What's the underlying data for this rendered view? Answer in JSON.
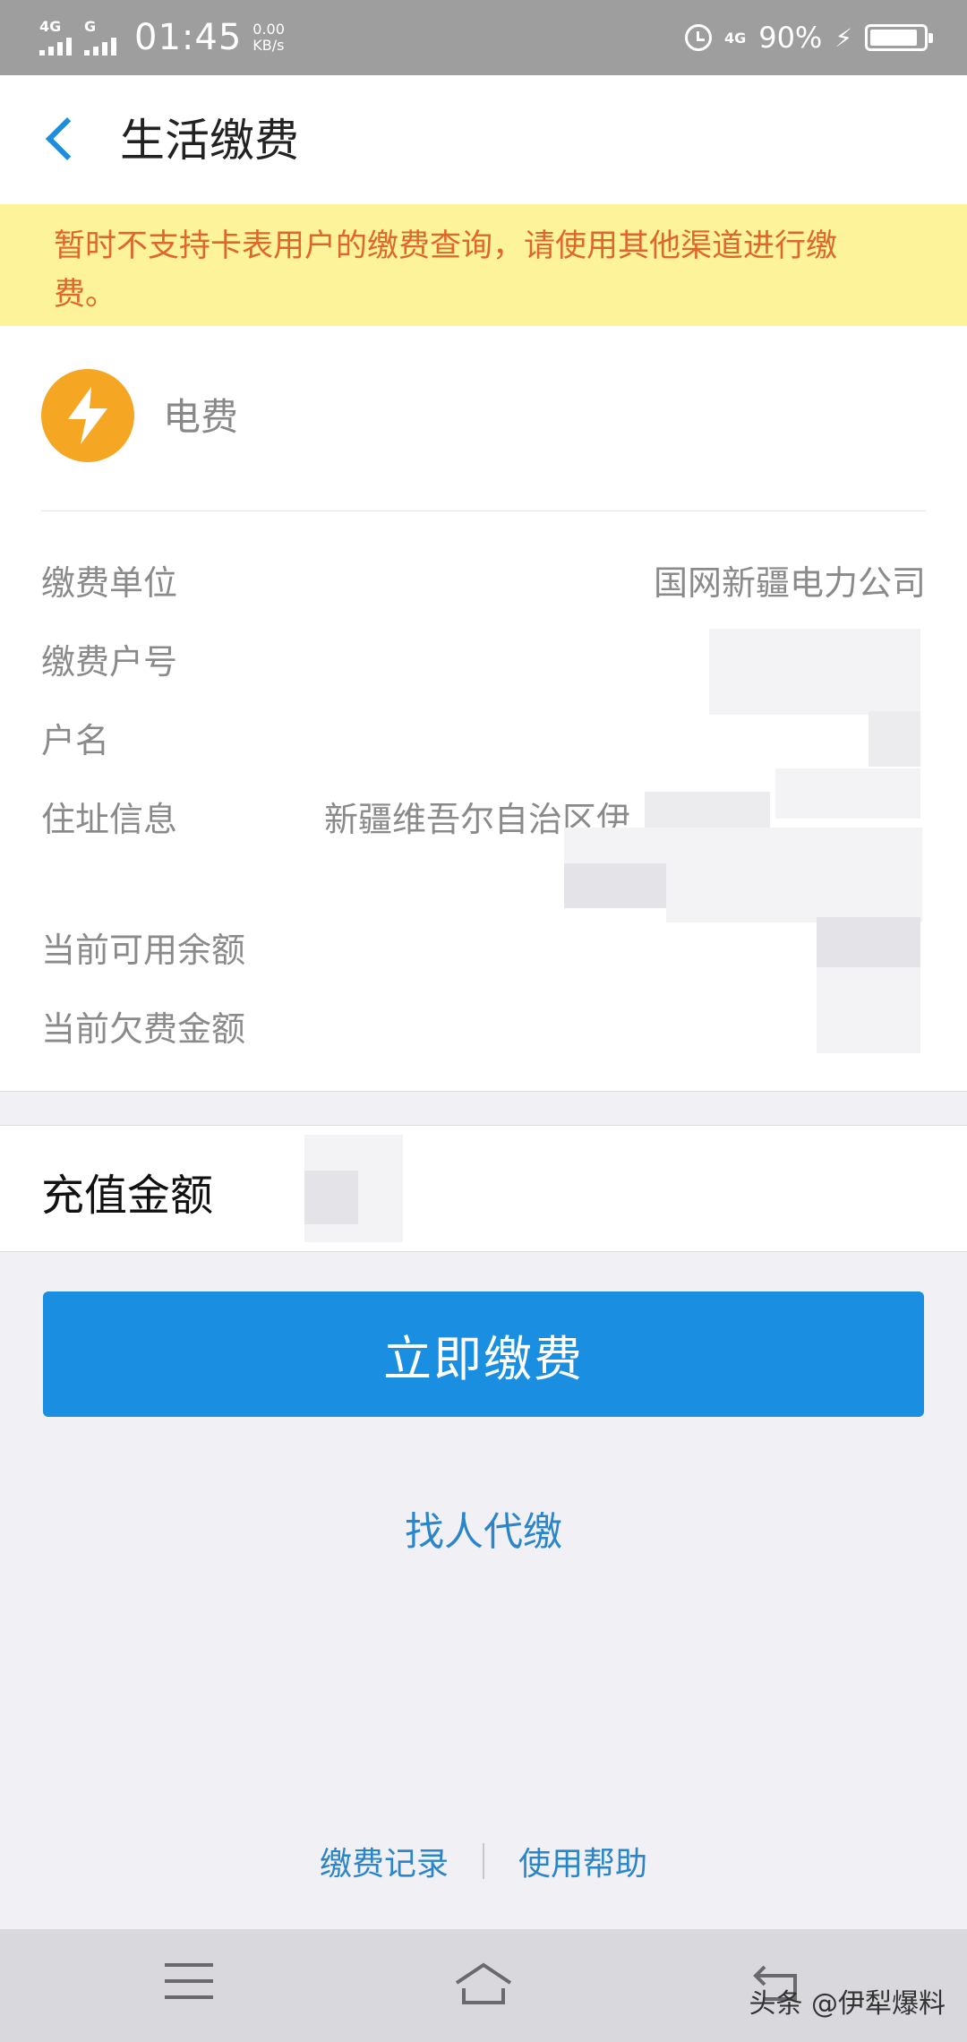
{
  "status_bar": {
    "network_left": "4G",
    "network_right": "G",
    "time": "01:45",
    "speed_value": "0.00",
    "speed_unit": "KB/s",
    "network_status": "4G",
    "battery": "90%"
  },
  "header": {
    "title": "生活缴费"
  },
  "notice": "暂时不支持卡表用户的缴费查询，请使用其他渠道进行缴费。",
  "bill": {
    "name": "电费",
    "icon": "lightning-bolt-icon",
    "rows": [
      {
        "label": "缴费单位",
        "value": "国网新疆电力公司"
      },
      {
        "label": "缴费户号",
        "value": ""
      },
      {
        "label": "户名",
        "value": ""
      },
      {
        "label": "住址信息",
        "value": "新疆维吾尔自治区伊"
      },
      {
        "label": "当前可用余额",
        "value": ""
      },
      {
        "label": "当前欠费金额",
        "value": ""
      }
    ]
  },
  "recharge": {
    "label": "充值金额"
  },
  "pay_button": "立即缴费",
  "proxy_link": "找人代缴",
  "footer": {
    "records": "缴费记录",
    "help": "使用帮助"
  },
  "watermark": "头条 @伊犁爆料",
  "colors": {
    "accent": "#1a8ee0",
    "notice_bg": "#fdf39a",
    "notice_text": "#e0672a",
    "bill_icon": "#f5a623"
  }
}
